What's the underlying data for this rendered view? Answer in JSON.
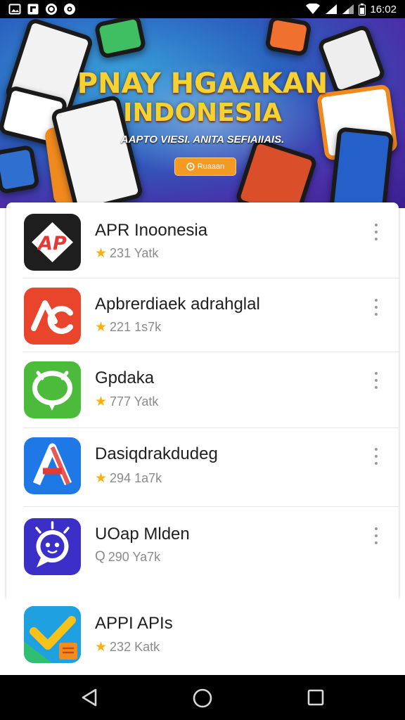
{
  "status_bar": {
    "time": "16:02",
    "icons": [
      "image-icon",
      "photo-icon",
      "record-icon",
      "settings-icon"
    ]
  },
  "banner": {
    "title_line1": "PNAY HGAAKAN",
    "title_line2": "INDONESIA",
    "subtitle": "AAPTO VIESI. ANITA SEFIAIIAIS.",
    "button_label": "Ruaaan"
  },
  "apps": [
    {
      "name": "APR Inoonesia",
      "rating": "231 Yatk",
      "rating_icon": "star-icon",
      "icon": "ap-logo-icon",
      "colors": [
        "#1e1e1e",
        "#e53935"
      ]
    },
    {
      "name": "Apbrerdiaek adrahglal",
      "rating": "221 1s7k",
      "rating_icon": "star-icon",
      "icon": "ac-logo-icon",
      "colors": [
        "#e8452c",
        "#ffffff"
      ]
    },
    {
      "name": "Gpdaka",
      "rating": "777 Yatk",
      "rating_icon": "star-icon",
      "icon": "bubble-logo-icon",
      "colors": [
        "#4cbb3c",
        "#ffffff"
      ]
    },
    {
      "name": "Dasiqdrakdudeg",
      "rating": "294 1a7k",
      "rating_icon": "star-icon",
      "icon": "a-logo-icon",
      "colors": [
        "#1e78e6",
        "#e53935"
      ]
    },
    {
      "name": "UOap Mlden",
      "rating": "290 Ya7k",
      "rating_icon": "q-icon",
      "icon": "chat-face-icon",
      "colors": [
        "#3b2fc8",
        "#ffffff"
      ]
    },
    {
      "name": "APPI APIs",
      "rating": "232 Katk",
      "rating_icon": "star-icon",
      "icon": "check-logo-icon",
      "colors": [
        "#1fa0e0",
        "#f6c21a"
      ]
    }
  ],
  "nav": {
    "back": "back-icon",
    "home": "home-icon",
    "recents": "recents-icon"
  }
}
